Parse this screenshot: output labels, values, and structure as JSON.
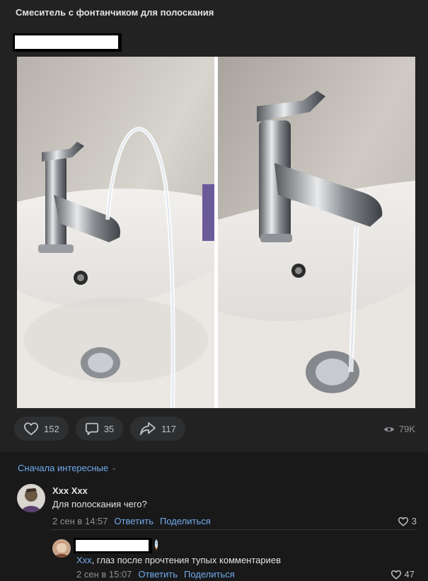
{
  "post": {
    "title": "Смеситель с фонтанчиком для полоскания",
    "actions": {
      "likes": "152",
      "comments": "35",
      "shares": "117",
      "views": "79K"
    },
    "photos": [
      {
        "alt": "faucet-arc-water"
      },
      {
        "alt": "faucet-down-water"
      }
    ]
  },
  "comments_section": {
    "sort_label": "Сначала интересные",
    "comments": [
      {
        "author": "Xxx Xxx",
        "text": "Для полоскания чего?",
        "time": "2 сен в 14:57",
        "reply_label": "Ответить",
        "share_label": "Поделиться",
        "likes": "3"
      }
    ],
    "replies": [
      {
        "mention": "Xxx",
        "text": ", глаз после прочтения тупых комментариев",
        "time": "2 сен в 15:07",
        "reply_label": "Ответить",
        "share_label": "Поделиться",
        "likes": "47"
      }
    ]
  },
  "colors": {
    "background": "#19191a",
    "card": "#222222",
    "accent_link": "#71aaeb",
    "pill": "#2e2f30"
  }
}
